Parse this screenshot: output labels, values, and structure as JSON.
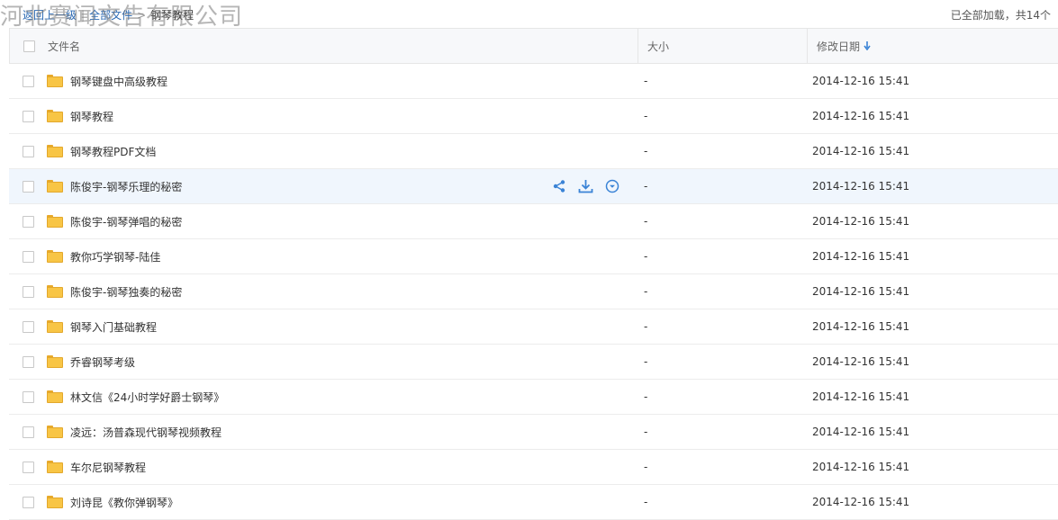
{
  "watermark": "河北赛闻文告有限公司",
  "breadcrumb": {
    "back": "返回上一级",
    "all_files": "全部文件",
    "separator": ">",
    "current": "钢琴教程"
  },
  "load_status": "已全部加载，共14个",
  "columns": {
    "name": "文件名",
    "size": "大小",
    "modified": "修改日期"
  },
  "sort_icon": "arrow-down-icon",
  "row_actions": [
    "share-icon",
    "download-icon",
    "more-dropdown-icon"
  ],
  "colors": {
    "link": "#2b6ab4",
    "folder": "#f8c545",
    "hover_row": "#f0f6fd",
    "action_icon": "#3a83d6"
  },
  "files": [
    {
      "name": "钢琴键盘中高级教程",
      "size": "-",
      "modified": "2014-12-16 15:41"
    },
    {
      "name": "钢琴教程",
      "size": "-",
      "modified": "2014-12-16 15:41"
    },
    {
      "name": "钢琴教程PDF文档",
      "size": "-",
      "modified": "2014-12-16 15:41"
    },
    {
      "name": "陈俊宇-钢琴乐理的秘密",
      "size": "-",
      "modified": "2014-12-16 15:41"
    },
    {
      "name": "陈俊宇-钢琴弹唱的秘密",
      "size": "-",
      "modified": "2014-12-16 15:41"
    },
    {
      "name": "教你巧学钢琴-陆佳",
      "size": "-",
      "modified": "2014-12-16 15:41"
    },
    {
      "name": "陈俊宇-钢琴独奏的秘密",
      "size": "-",
      "modified": "2014-12-16 15:41"
    },
    {
      "name": "钢琴入门基础教程",
      "size": "-",
      "modified": "2014-12-16 15:41"
    },
    {
      "name": "乔睿钢琴考级",
      "size": "-",
      "modified": "2014-12-16 15:41"
    },
    {
      "name": "林文信《24小时学好爵士钢琴》",
      "size": "-",
      "modified": "2014-12-16 15:41"
    },
    {
      "name": "凌远：汤普森现代钢琴视频教程",
      "size": "-",
      "modified": "2014-12-16 15:41"
    },
    {
      "name": "车尔尼钢琴教程",
      "size": "-",
      "modified": "2014-12-16 15:41"
    },
    {
      "name": "刘诗昆《教你弹钢琴》",
      "size": "-",
      "modified": "2014-12-16 15:41"
    }
  ]
}
